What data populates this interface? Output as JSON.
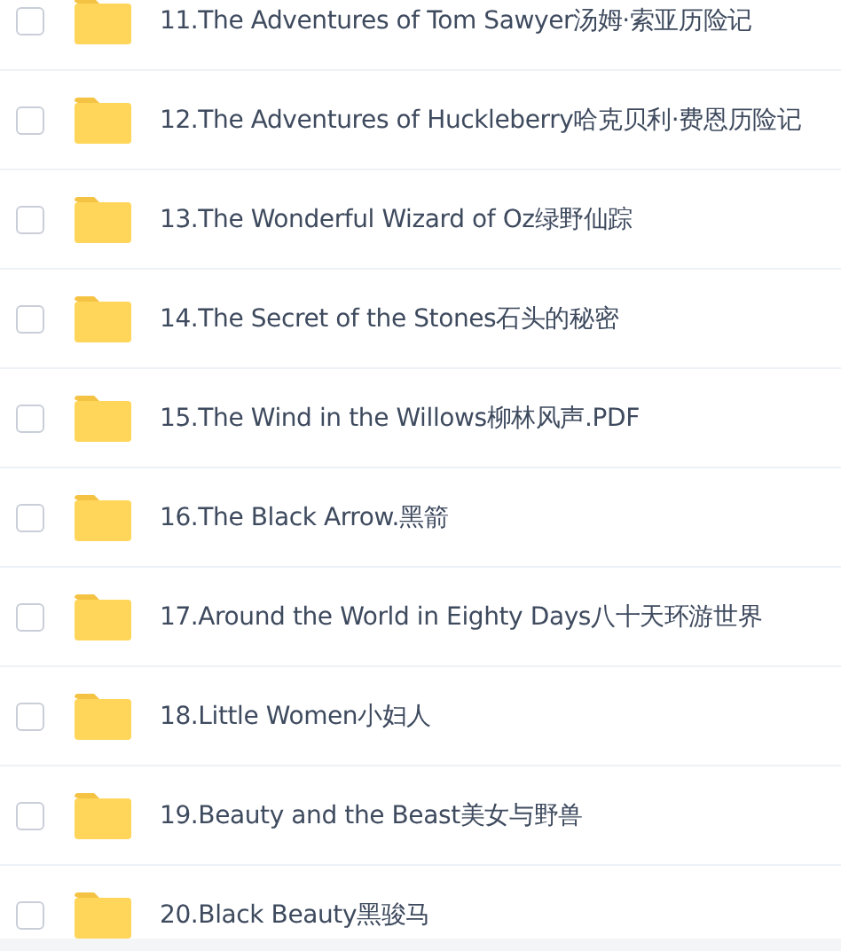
{
  "files": [
    {
      "name": "11.The Adventures of Tom Sawyer汤姆·索亚历险记",
      "checked": false
    },
    {
      "name": "12.The Adventures of Huckleberry哈克贝利·费恩历险记",
      "checked": false
    },
    {
      "name": "13.The Wonderful Wizard of Oz绿野仙踪",
      "checked": false
    },
    {
      "name": "14.The Secret of the Stones石头的秘密",
      "checked": false
    },
    {
      "name": "15.The Wind in the Willows柳林风声.PDF",
      "checked": false
    },
    {
      "name": "16.The Black Arrow.黑箭",
      "checked": false
    },
    {
      "name": "17.Around the World in Eighty Days八十天环游世界",
      "checked": false
    },
    {
      "name": "18.Little Women小妇人",
      "checked": false
    },
    {
      "name": "19.Beauty and the Beast美女与野兽",
      "checked": false
    },
    {
      "name": "20.Black Beauty黑骏马",
      "checked": false
    }
  ]
}
